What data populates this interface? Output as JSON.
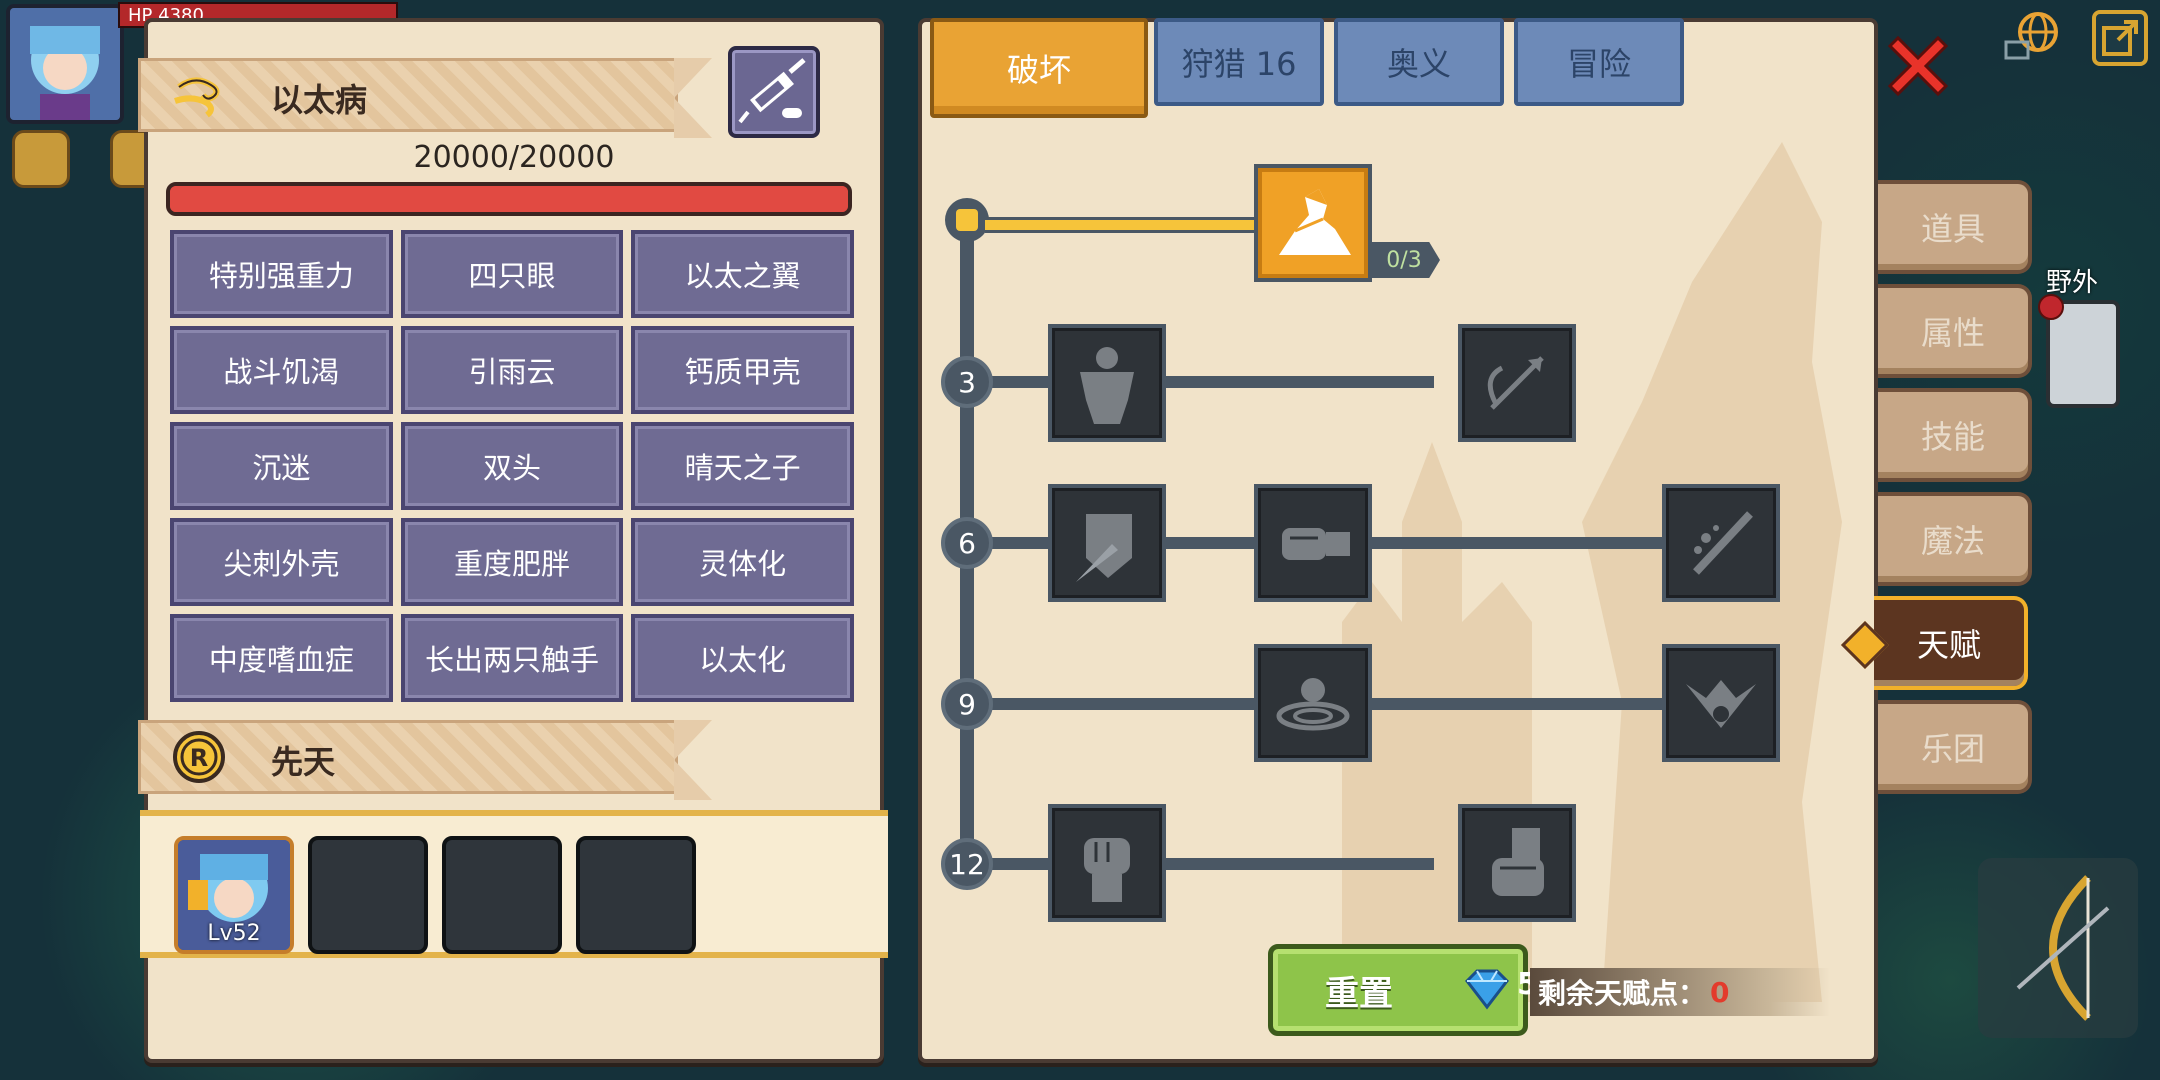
{
  "hud": {
    "hp_label": "HP 4380"
  },
  "disease_panel": {
    "title": "以太病",
    "hp": "20000/20000",
    "hp_fraction": 1.0,
    "traits": [
      "特别强重力",
      "四只眼",
      "以太之翼",
      "战斗饥渴",
      "引雨云",
      "钙质甲壳",
      "沉迷",
      "双头",
      "晴天之子",
      "尖刺外壳",
      "重度肥胖",
      "灵体化",
      "中度嗜血症",
      "长出两只触手",
      "以太化"
    ],
    "innate_title": "先天",
    "innate_slots": [
      {
        "level": "Lv52"
      },
      {},
      {},
      {}
    ]
  },
  "talent_panel": {
    "tabs": [
      {
        "label": "破坏",
        "active": true
      },
      {
        "label": "狩猎 16",
        "active": false
      },
      {
        "label": "奥义",
        "active": false
      },
      {
        "label": "冒险",
        "active": false
      }
    ],
    "top_skill": {
      "icon": "arm-wrestle-icon",
      "counter": "0/3"
    },
    "rows": [
      {
        "level": "3",
        "skills": [
          "muscle-body-icon",
          "dodge-arrow-icon"
        ]
      },
      {
        "level": "6",
        "skills": [
          "shield-slash-icon",
          "fist-punch-icon",
          "sword-splash-icon"
        ]
      },
      {
        "level": "9",
        "skills": [
          "ripple-orb-icon",
          "demon-wings-icon"
        ]
      },
      {
        "level": "12",
        "skills": [
          "raised-fist-icon",
          "gauntlet-fist-icon"
        ]
      }
    ],
    "reset_label": "重置",
    "reset_cost": "5",
    "remaining_label": "剩余天赋点：",
    "remaining_value": "0"
  },
  "side_menu": {
    "items": [
      {
        "label": "道具",
        "active": false
      },
      {
        "label": "属性",
        "active": false
      },
      {
        "label": "技能",
        "active": false
      },
      {
        "label": "魔法",
        "active": false
      },
      {
        "label": "天赋",
        "active": true
      },
      {
        "label": "乐团",
        "active": false
      }
    ]
  },
  "world": {
    "wild_label": "野外"
  },
  "colors": {
    "accent": "#e9a334",
    "hp": "#d9413a",
    "reset": "#8ec44a",
    "remaining_zero": "#e33b2c"
  }
}
